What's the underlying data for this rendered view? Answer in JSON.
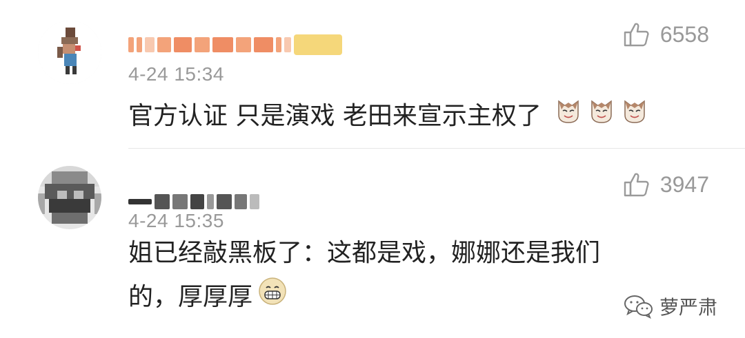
{
  "comments": [
    {
      "username": "",
      "timestamp": "4-24 15:34",
      "likes": "6558",
      "text": "官方认证 只是演戏 老田来宣示主权了",
      "emojis": [
        "cat-face-icon",
        "cat-face-icon",
        "cat-face-icon"
      ]
    },
    {
      "username": "",
      "timestamp": "4-24 15:35",
      "likes": "3947",
      "text_line1": "姐已经敲黑板了：这都是戏，娜娜还是我们",
      "text_line2": "的，厚厚厚",
      "emojis": [
        "grinning-face-icon"
      ]
    }
  ],
  "watermark": {
    "label": "萝严肃",
    "icon": "wechat-icon"
  },
  "colors": {
    "meta_gray": "#999999",
    "text": "#222222",
    "divider": "#e6e6e6",
    "username_orange": "#f08a5d"
  }
}
